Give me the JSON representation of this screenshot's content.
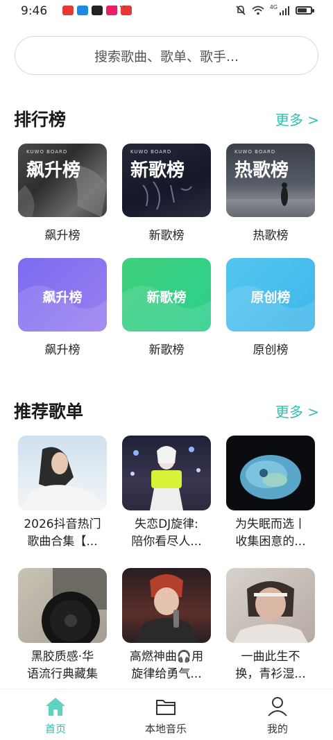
{
  "status": {
    "time": "9:46",
    "network": "4G",
    "battery_level": 0.7
  },
  "search": {
    "placeholder": "搜索歌曲、歌单、歌手..."
  },
  "ranking": {
    "title": "排行榜",
    "more": "更多 >",
    "items": [
      {
        "cover_text": "飙升榜",
        "label": "飙升榜",
        "board": "KUWO BOARD"
      },
      {
        "cover_text": "新歌榜",
        "label": "新歌榜",
        "board": "KUWO BOARD"
      },
      {
        "cover_text": "热歌榜",
        "label": "热歌榜",
        "board": "KUWO BOARD"
      },
      {
        "cover_text": "飙升榜",
        "label": "飙升榜"
      },
      {
        "cover_text": "新歌榜",
        "label": "新歌榜"
      },
      {
        "cover_text": "原创榜",
        "label": "原创榜"
      }
    ]
  },
  "playlists": {
    "title": "推荐歌单",
    "more": "更多 >",
    "items": [
      {
        "line1": "2026抖音热门",
        "line2": "歌曲合集【..."
      },
      {
        "line1": "失恋DJ旋律:",
        "line2": "陪你看尽人..."
      },
      {
        "line1": "为失眠而选丨",
        "line2": "收集困意的..."
      },
      {
        "line1": "黑胶质感·华",
        "line2": "语流行典藏集"
      },
      {
        "line1": "高燃神曲🎧用",
        "line2": "旋律给勇气..."
      },
      {
        "line1": "一曲此生不",
        "line2": "换，青衫湿..."
      }
    ]
  },
  "nav": {
    "home": "首页",
    "local": "本地音乐",
    "mine": "我的"
  },
  "colors": {
    "accent": "#2fc0ad"
  }
}
